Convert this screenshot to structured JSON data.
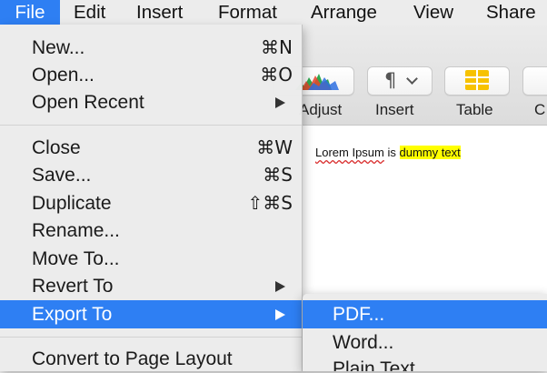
{
  "menubar": {
    "items": [
      "File",
      "Edit",
      "Insert",
      "Format",
      "Arrange",
      "View",
      "Share"
    ]
  },
  "toolbar": {
    "adjust_label": "Adjust",
    "insert_label": "Insert",
    "table_label": "Table",
    "partial_label": "C"
  },
  "document": {
    "text_part1": "Lorem Ipsum",
    "text_part2": " is ",
    "text_highlight": "dummy text",
    "highlight_color": "#ffff00"
  },
  "file_menu": {
    "items": [
      {
        "label": "New...",
        "shortcut": "⌘N"
      },
      {
        "label": "Open...",
        "shortcut": "⌘O"
      },
      {
        "label": "Open Recent",
        "submenu": true
      },
      {
        "label": "Close",
        "shortcut": "⌘W"
      },
      {
        "label": "Save...",
        "shortcut": "⌘S"
      },
      {
        "label": "Duplicate",
        "shortcut": "⇧⌘S"
      },
      {
        "label": "Rename..."
      },
      {
        "label": "Move To..."
      },
      {
        "label": "Revert To",
        "submenu": true
      },
      {
        "label": "Export To",
        "submenu": true,
        "selected": true
      },
      {
        "label": "Convert to Page Layout"
      }
    ]
  },
  "export_submenu": {
    "items": [
      {
        "label": "PDF...",
        "selected": true
      },
      {
        "label": "Word..."
      },
      {
        "label": "Plain Text"
      }
    ]
  },
  "colors": {
    "accent": "#2e7ff3",
    "menu_bg": "#ececec"
  }
}
